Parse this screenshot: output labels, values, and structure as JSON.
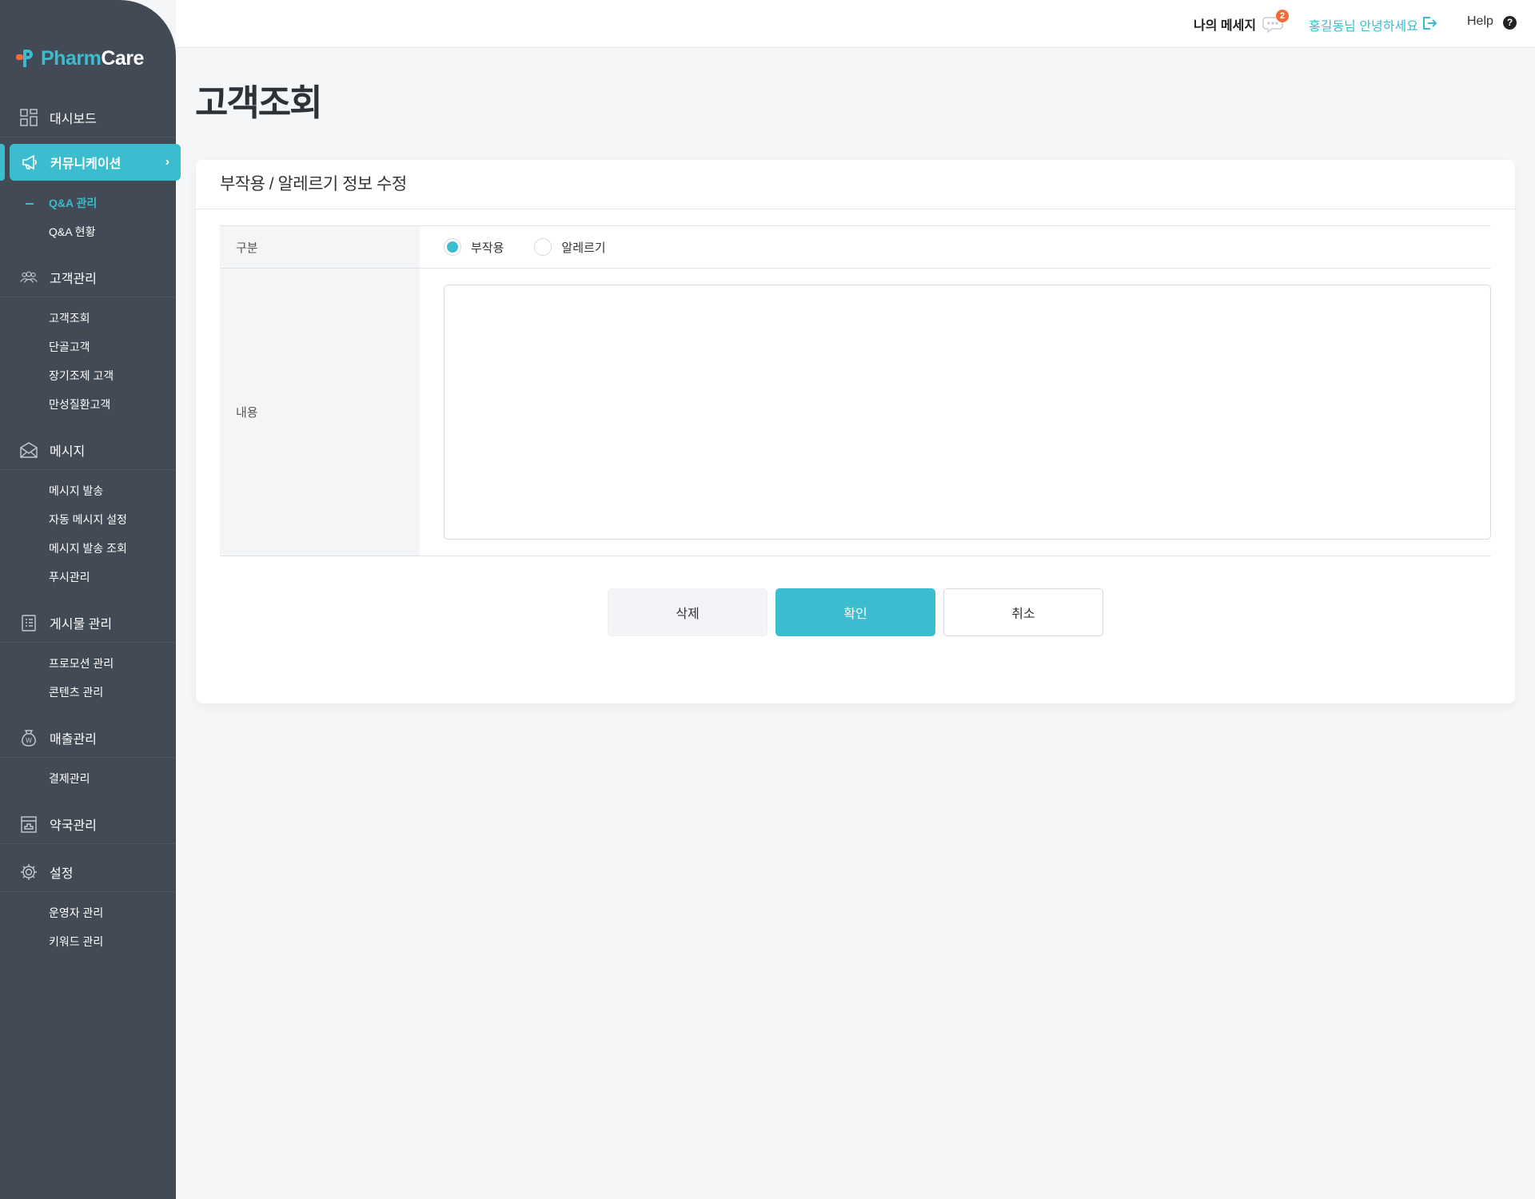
{
  "app": {
    "brand_part1": "Pharm",
    "brand_part2": "Care"
  },
  "topbar": {
    "messages_label": "나의 메세지",
    "messages_count": "2",
    "user_greeting": "홍길동님 안녕하세요",
    "help_label": "Help",
    "help_icon_text": "?"
  },
  "sidebar": {
    "dashboard": "대시보드",
    "communication": "커뮤니케이션",
    "communication_sub": [
      "Q&A 관리",
      "Q&A 현황"
    ],
    "customers": "고객관리",
    "customers_sub": [
      "고객조회",
      "단골고객",
      "장기조제 고객",
      "만성질환고객"
    ],
    "messages": "메시지",
    "messages_sub": [
      "메시지 발송",
      "자동 메시지 설정",
      "메시지 발송 조회",
      "푸시관리"
    ],
    "posts": "게시물 관리",
    "posts_sub": [
      "프로모션 관리",
      "콘텐츠 관리"
    ],
    "sales": "매출관리",
    "sales_sub": [
      "결제관리"
    ],
    "pharmacy": "약국관리",
    "settings": "설정",
    "settings_sub": [
      "운영자 관리",
      "키워드 관리"
    ]
  },
  "main": {
    "page_title": "고객조회",
    "card_title": "부작용 / 알레르기 정보 수정",
    "form": {
      "type_label": "구분",
      "type_options": [
        "부작용",
        "알레르기"
      ],
      "type_selected": "부작용",
      "content_label": "내용",
      "content_value": ""
    },
    "buttons": {
      "delete": "삭제",
      "confirm": "확인",
      "cancel": "취소"
    }
  },
  "colors": {
    "accent": "#3bbccf",
    "sidebar_bg": "#424a55",
    "badge": "#f26b3a",
    "page_bg": "#f4f6f8"
  }
}
